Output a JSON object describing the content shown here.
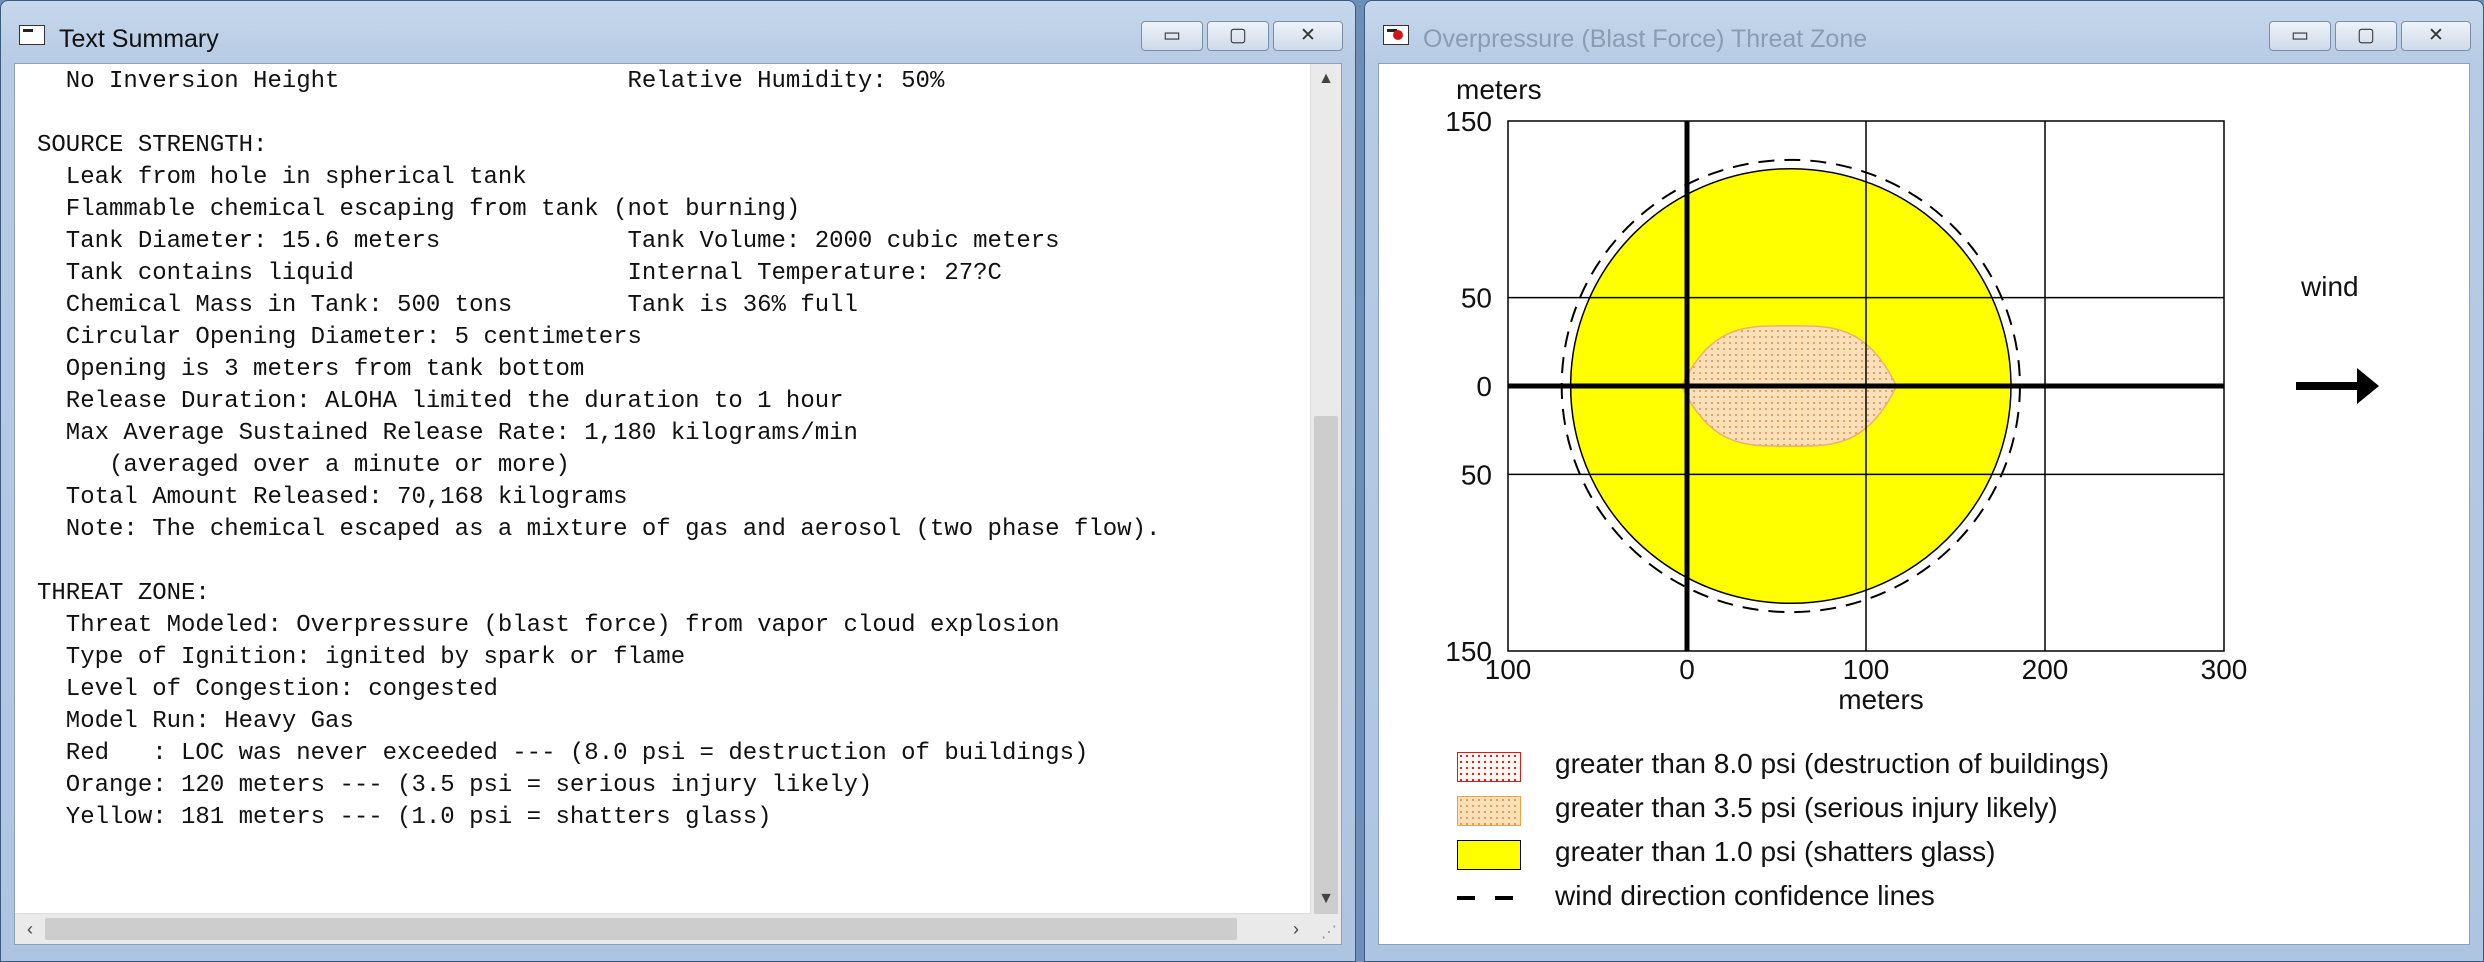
{
  "left_window": {
    "title": "Text Summary",
    "lines": [
      "  No Inversion Height                    Relative Humidity: 50%",
      "",
      "SOURCE STRENGTH:",
      "  Leak from hole in spherical tank",
      "  Flammable chemical escaping from tank (not burning)",
      "  Tank Diameter: 15.6 meters             Tank Volume: 2000 cubic meters",
      "  Tank contains liquid                   Internal Temperature: 27?C",
      "  Chemical Mass in Tank: 500 tons        Tank is 36% full",
      "  Circular Opening Diameter: 5 centimeters",
      "  Opening is 3 meters from tank bottom",
      "  Release Duration: ALOHA limited the duration to 1 hour",
      "  Max Average Sustained Release Rate: 1,180 kilograms/min",
      "     (averaged over a minute or more)",
      "  Total Amount Released: 70,168 kilograms",
      "  Note: The chemical escaped as a mixture of gas and aerosol (two phase flow).",
      "",
      "THREAT ZONE:",
      "  Threat Modeled: Overpressure (blast force) from vapor cloud explosion",
      "  Type of Ignition: ignited by spark or flame",
      "  Level of Congestion: congested",
      "  Model Run: Heavy Gas",
      "  Red   : LOC was never exceeded --- (8.0 psi = destruction of buildings)",
      "  Orange: 120 meters --- (3.5 psi = serious injury likely)",
      "  Yellow: 181 meters --- (1.0 psi = shatters glass)"
    ]
  },
  "right_window": {
    "title": "Overpressure (Blast Force) Threat Zone",
    "chart_data": {
      "type": "area",
      "ylabel": "meters",
      "xlabel": "meters",
      "x_ticks": [
        "100",
        "0",
        "100",
        "200",
        "300"
      ],
      "y_ticks": [
        "150",
        "50",
        "0",
        "50",
        "150"
      ],
      "xlim": [
        -100,
        300
      ],
      "ylim": [
        -150,
        150
      ],
      "grid": true,
      "wind_label": "wind",
      "zones": [
        {
          "name": "greater than 3.5 psi (serious injury likely)",
          "color": "#fbe0b8",
          "x_range": [
            -3,
            117
          ],
          "half_width": 34
        },
        {
          "name": "greater than 1.0 psi (shatters glass)",
          "color": "#ffff00",
          "center_x": 58,
          "radius": 123
        }
      ],
      "confidence_circle": {
        "center_x": 58,
        "radius": 128
      }
    },
    "legend": [
      {
        "label": "greater than 8.0 psi (destruction of buildings)",
        "swatch": "red"
      },
      {
        "label": "greater than 3.5 psi (serious injury likely)",
        "swatch": "orange"
      },
      {
        "label": "greater than 1.0 psi (shatters glass)",
        "swatch": "yellow"
      },
      {
        "label": "wind direction confidence lines",
        "swatch": "dash"
      }
    ]
  },
  "caption_buttons": {
    "minimize": "▭",
    "maximize": "▢",
    "close": "✕"
  },
  "scroll_arrows": {
    "up": "▲",
    "down": "▼",
    "left": "‹",
    "right": "›"
  }
}
